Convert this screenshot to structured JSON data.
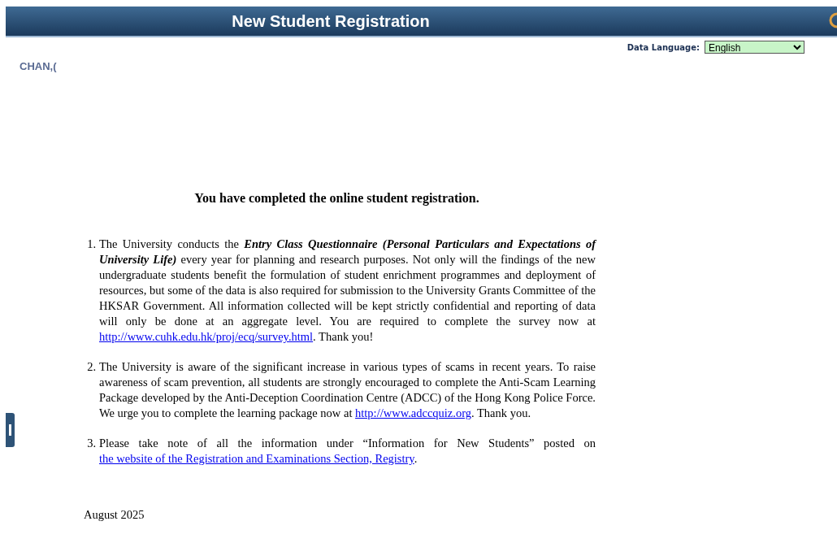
{
  "header": {
    "title": "New Student Registration"
  },
  "language": {
    "label": "Data Language:",
    "value": "English"
  },
  "user_name": "CHAN,(",
  "heading": "You have completed the online student registration.",
  "items": [
    {
      "number": "1.",
      "segments": [
        {
          "kind": "text",
          "text": "The University conducts the "
        },
        {
          "kind": "emphasis",
          "text": "Entry Class Questionnaire (Personal Particulars and Expectations of University Life)"
        },
        {
          "kind": "text",
          "text": " every year for planning and research purposes. Not only will the findings of the new undergraduate students benefit the formulation of student enrichment programmes and deployment of resources, but some of the data is also required for submission to the University Grants Committee of the HKSAR Government. All information collected will be kept strictly confidential and reporting of data will only be done at an aggregate level. You are required to complete the survey now at "
        },
        {
          "kind": "link",
          "text": "http://www.cuhk.edu.hk/proj/ecq/survey.html"
        },
        {
          "kind": "text",
          "text": ". Thank you!"
        }
      ]
    },
    {
      "number": "2.",
      "segments": [
        {
          "kind": "text",
          "text": "The University is aware of the significant increase in various types of scams in recent years. To raise awareness of scam prevention, all students are strongly encouraged to complete the Anti-Scam Learning Package developed by the Anti-Deception Coordination Centre (ADCC) of the Hong Kong Police Force. We urge you to complete the learning package now at "
        },
        {
          "kind": "link",
          "text": "http://www.adccquiz.org"
        },
        {
          "kind": "text",
          "text": ". Thank you."
        }
      ]
    },
    {
      "number": "3.",
      "segments": [
        {
          "kind": "text",
          "text": "Please take note of all the information under “Information for New Students” posted on "
        },
        {
          "kind": "link",
          "text": "the website of the Registration and Examinations Section, Registry"
        },
        {
          "kind": "text",
          "text": "."
        }
      ]
    }
  ],
  "date": "August 2025"
}
